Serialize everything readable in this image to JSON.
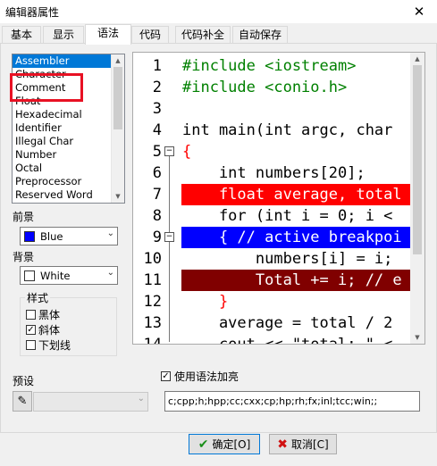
{
  "window": {
    "title": "编辑器属性",
    "close_glyph": "✕"
  },
  "tabs": [
    {
      "label": "基本"
    },
    {
      "label": "显示"
    },
    {
      "label": "语法"
    },
    {
      "label": "代码"
    },
    {
      "label": "代码补全"
    },
    {
      "label": "自动保存"
    }
  ],
  "element_list": [
    "Assembler",
    "Character",
    "Comment",
    "Float",
    "Hexadecimal",
    "Identifier",
    "Illegal Char",
    "Number",
    "Octal",
    "Preprocessor",
    "Reserved Word"
  ],
  "selected_element": "Assembler",
  "foreground": {
    "label": "前景",
    "value": "Blue",
    "color": "#0000ff"
  },
  "background": {
    "label": "背景",
    "value": "White",
    "color": "#ffffff"
  },
  "style_group": {
    "label": "样式",
    "bold": {
      "label": "黑体",
      "checked": false
    },
    "italic": {
      "label": "斜体",
      "checked": true
    },
    "underline": {
      "label": "下划线",
      "checked": false
    }
  },
  "preset": {
    "label": "预设",
    "value": ""
  },
  "syntax_highlight": {
    "label": "使用语法加亮",
    "checked": true
  },
  "extensions": "c;cpp;h;hpp;cc;cxx;cp;hp;rh;fx;inl;tcc;win;;",
  "code_lines": [
    {
      "num": "1",
      "text": "#include <iostream>"
    },
    {
      "num": "2",
      "text": "#include <conio.h>"
    },
    {
      "num": "3",
      "text": ""
    },
    {
      "num": "4",
      "text": "int main(int argc, char"
    },
    {
      "num": "5",
      "text": "{"
    },
    {
      "num": "6",
      "text": "    int numbers[20];"
    },
    {
      "num": "7",
      "text": "    float average, total"
    },
    {
      "num": "8",
      "text": "    for (int i = 0; i <"
    },
    {
      "num": "9",
      "text": "    { // active breakpoi"
    },
    {
      "num": "10",
      "text": "        numbers[i] = i;"
    },
    {
      "num": "11",
      "text": "        Total += i; // e"
    },
    {
      "num": "12",
      "text": "    }"
    },
    {
      "num": "13",
      "text": "    average = total / 2"
    },
    {
      "num": "14",
      "text": "    cout << \"total: \" <"
    }
  ],
  "colors": {
    "error_line": "#ff0000",
    "breakpoint_line": "#0000ff",
    "error2_line": "#800000",
    "preprocessor": "#008000",
    "symbol": "#ff0000"
  },
  "buttons": {
    "ok": "确定[O]",
    "cancel": "取消[C]"
  }
}
